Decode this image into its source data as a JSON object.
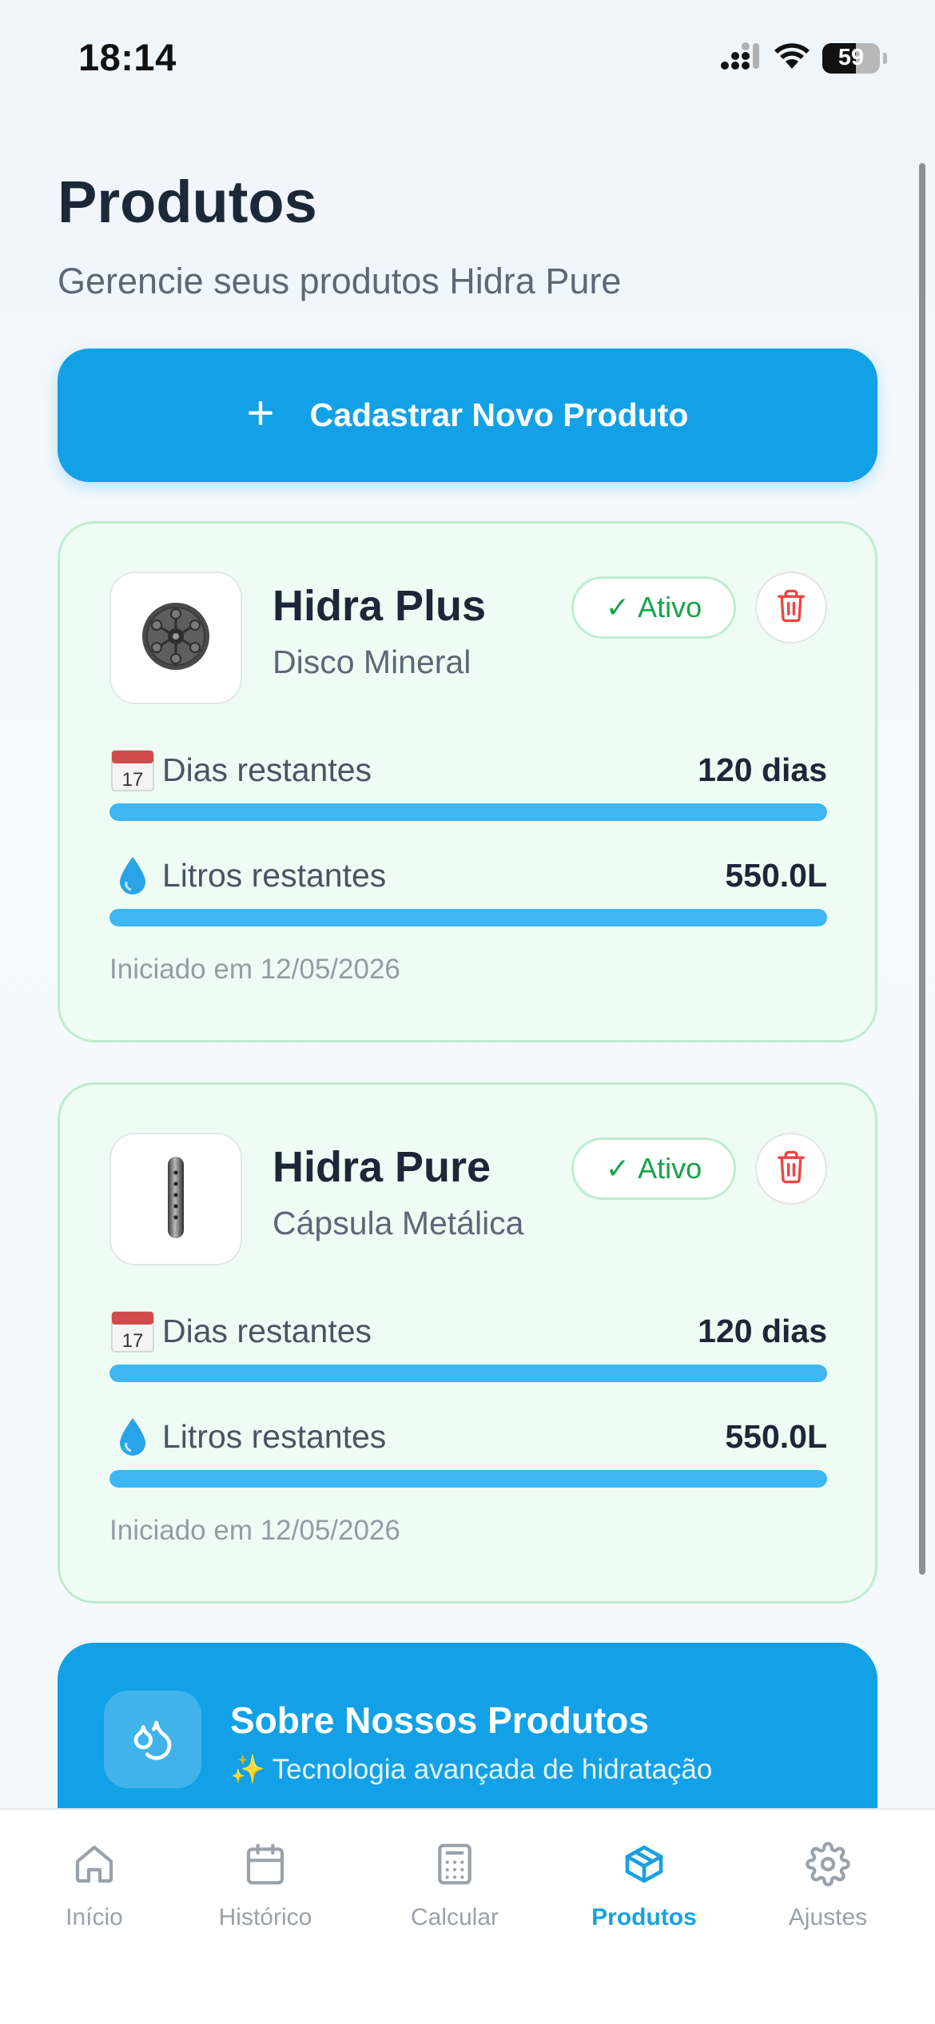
{
  "status_bar": {
    "time": "18:14",
    "battery": "59"
  },
  "header": {
    "title": "Produtos",
    "subtitle": "Gerencie seus produtos Hidra Pure"
  },
  "add_button": {
    "icon": "plus-icon",
    "label": "Cadastrar Novo Produto"
  },
  "products": [
    {
      "name": "Hidra Plus",
      "type": "Disco Mineral",
      "status": "Ativo",
      "days_label": "Dias restantes",
      "days_value": "120 dias",
      "days_progress": 1.0,
      "liters_label": "Litros restantes",
      "liters_value": "550.0L",
      "liters_progress": 1.0,
      "started": "Iniciado em 12/05/2026",
      "thumb_icon": "mineral-disc-icon"
    },
    {
      "name": "Hidra Pure",
      "type": "Cápsula Metálica",
      "status": "Ativo",
      "days_label": "Dias restantes",
      "days_value": "120 dias",
      "days_progress": 1.0,
      "liters_label": "Litros restantes",
      "liters_value": "550.0L",
      "liters_progress": 1.0,
      "started": "Iniciado em 12/05/2026",
      "thumb_icon": "metal-capsule-icon"
    }
  ],
  "info_card": {
    "title": "Sobre Nossos Produtos",
    "subtitle": "✨ Tecnologia avançada de hidratação"
  },
  "tabs": [
    {
      "label": "Início",
      "icon": "home-icon",
      "active": false
    },
    {
      "label": "Histórico",
      "icon": "calendar-icon",
      "active": false
    },
    {
      "label": "Calcular",
      "icon": "calculator-icon",
      "active": false
    },
    {
      "label": "Produtos",
      "icon": "box-icon",
      "active": true
    },
    {
      "label": "Ajustes",
      "icon": "gear-icon",
      "active": false
    }
  ],
  "colors": {
    "primary": "#12a1e6",
    "card_bg": "#effcf5",
    "card_border": "#bfeccf",
    "success": "#16a34a",
    "danger": "#ef4444",
    "progress": "#3db6f3",
    "tab_active": "#1aa0e2",
    "tab_inactive": "#9aa1a9"
  }
}
